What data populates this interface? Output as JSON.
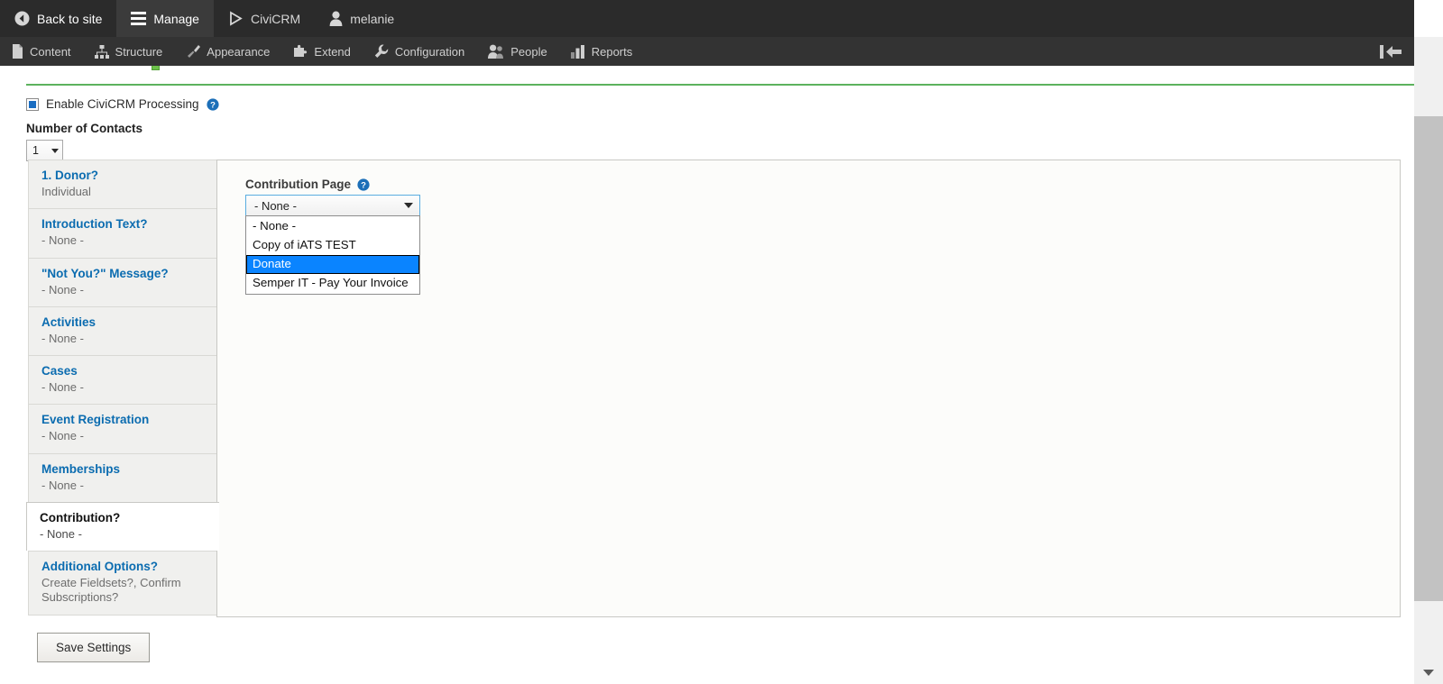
{
  "toolbar": {
    "primary": [
      {
        "label": "Back to site",
        "icon": "back-circle-icon",
        "active": false
      },
      {
        "label": "Manage",
        "icon": "hamburger-icon",
        "active": true
      },
      {
        "label": "CiviCRM",
        "icon": "civicrm-logo-icon",
        "active": false
      },
      {
        "label": "melanie",
        "icon": "user-icon",
        "active": false
      }
    ],
    "secondary": [
      {
        "label": "Content",
        "icon": "page-icon"
      },
      {
        "label": "Structure",
        "icon": "sitemap-icon"
      },
      {
        "label": "Appearance",
        "icon": "paintbrush-icon"
      },
      {
        "label": "Extend",
        "icon": "puzzle-icon"
      },
      {
        "label": "Configuration",
        "icon": "wrench-icon"
      },
      {
        "label": "People",
        "icon": "people-icon"
      },
      {
        "label": "Reports",
        "icon": "bar-chart-icon"
      }
    ],
    "collapse_icon": "collapse-left-icon",
    "active_bg": "#3b3b3b",
    "bar_bg": "#2b2b2b"
  },
  "form": {
    "enable_processing_label": "Enable CiviCRM Processing",
    "enable_processing_checked": true,
    "help_icon": "help-circle-icon",
    "number_of_contacts_label": "Number of Contacts",
    "number_of_contacts_value": "1",
    "accent_green": "#5cb25d",
    "link_blue": "#0b6cb0"
  },
  "tabs": [
    {
      "title": "1. Donor?",
      "sub": "Individual",
      "active": false
    },
    {
      "title": "Introduction Text?",
      "sub": "- None -",
      "active": false
    },
    {
      "title": "\"Not You?\" Message?",
      "sub": "- None -",
      "active": false
    },
    {
      "title": "Activities",
      "sub": "- None -",
      "active": false
    },
    {
      "title": "Cases",
      "sub": "- None -",
      "active": false
    },
    {
      "title": "Event Registration",
      "sub": "- None -",
      "active": false
    },
    {
      "title": "Memberships",
      "sub": "- None -",
      "active": false
    },
    {
      "title": "Contribution?",
      "sub": "- None -",
      "active": true
    },
    {
      "title": "Additional Options?",
      "sub": "Create Fieldsets?, Confirm Subscriptions?",
      "active": false
    }
  ],
  "panel": {
    "field_label": "Contribution Page",
    "select_value": "- None -",
    "options": [
      {
        "label": "- None -",
        "selected": false
      },
      {
        "label": "Copy of iATS TEST",
        "selected": false
      },
      {
        "label": "Donate",
        "selected": true
      },
      {
        "label": "Semper IT - Pay Your Invoice",
        "selected": false
      }
    ],
    "highlight_color": "#0a84ff",
    "focus_border": "#5aade0"
  },
  "actions": {
    "save_label": "Save Settings"
  },
  "scrollbar": {
    "down_arrow_icon": "chevron-down-icon"
  }
}
